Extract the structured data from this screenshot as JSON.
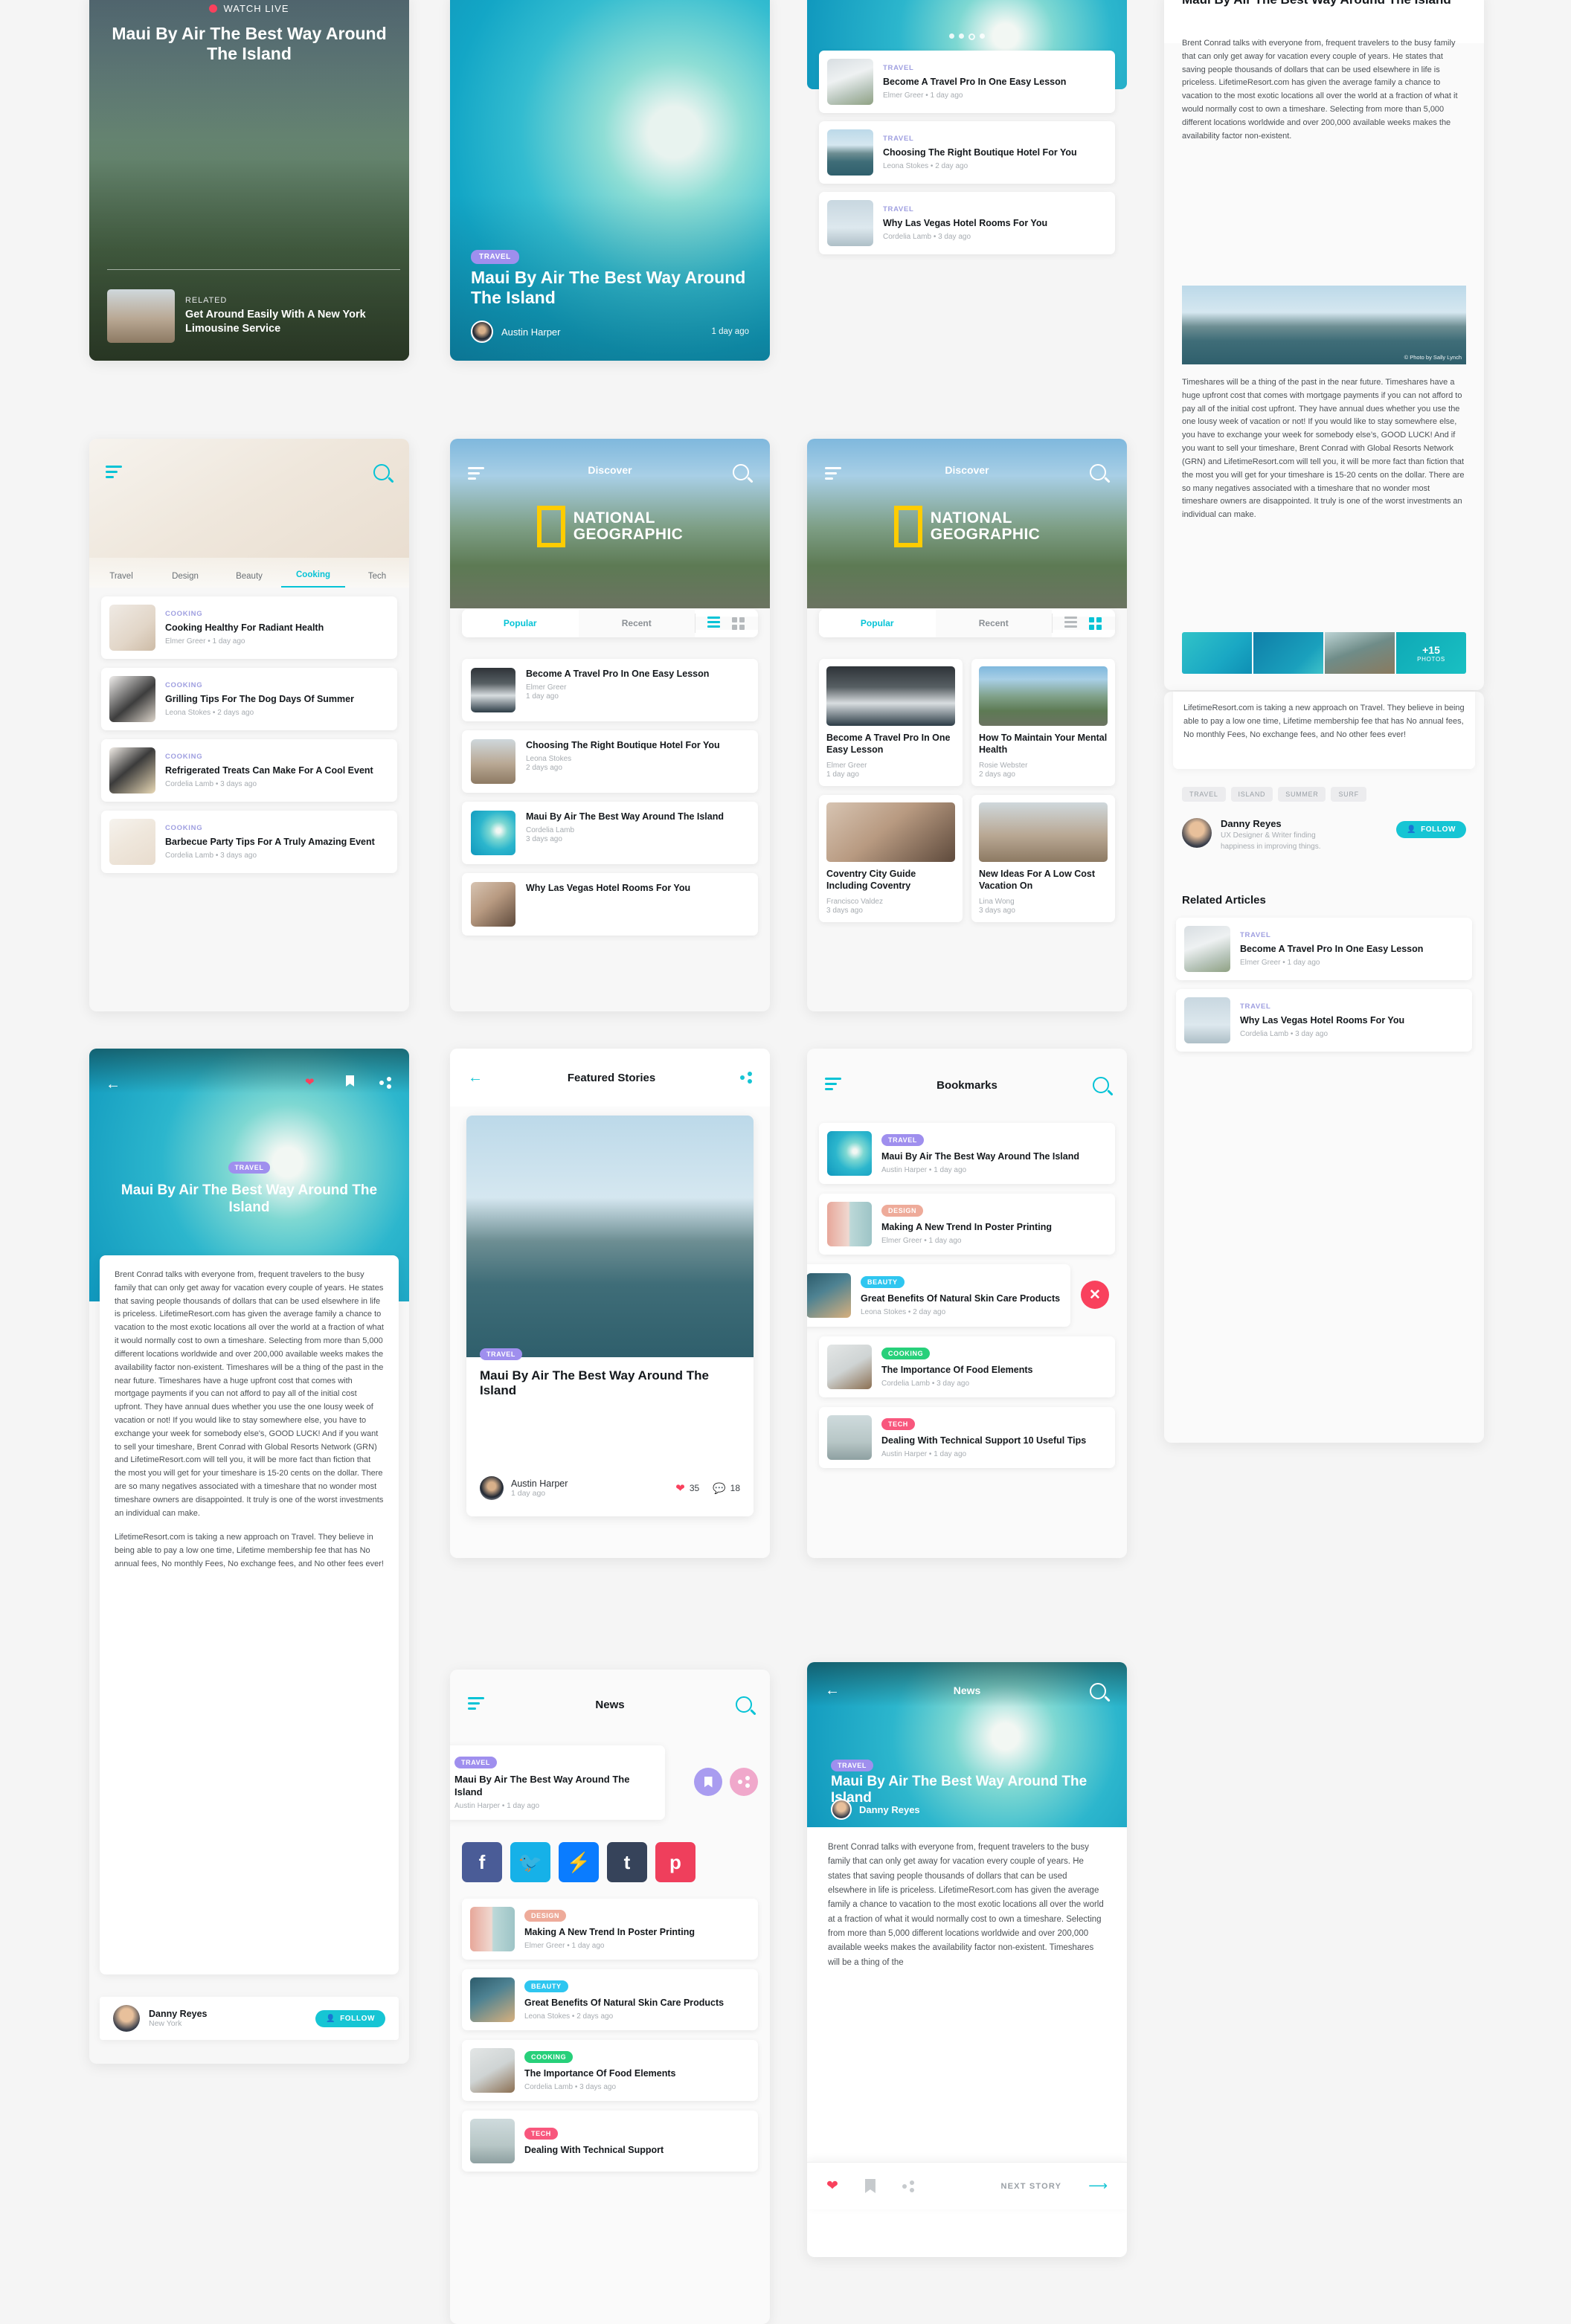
{
  "brand": {
    "accent": "#05c3d6",
    "red": "#f9415d",
    "purple": "#9f8fee"
  },
  "screen1_watch_live": {
    "live_label": "WATCH LIVE",
    "title": "Maui By Air The Best Way Around The Island",
    "related_label": "RELATED",
    "related_title": "Get Around Easily With A New York Limousine Service"
  },
  "screen2_hero": {
    "tag": "TRAVEL",
    "title": "Maui By Air The Best Way Around The Island",
    "author": "Austin Harper",
    "time": "1 day ago"
  },
  "screen3_carousel": {
    "dots": 5,
    "active_dot": 3,
    "items": [
      {
        "cat": "TRAVEL",
        "title": "Become A Travel Pro In One Easy Lesson",
        "meta": "Elmer Greer • 1 day ago"
      },
      {
        "cat": "TRAVEL",
        "title": "Choosing The Right Boutique Hotel For You",
        "meta": "Leona Stokes • 2 day ago"
      },
      {
        "cat": "TRAVEL",
        "title": "Why Las Vegas Hotel Rooms For You",
        "meta": "Cordelia Lamb • 3 day ago"
      }
    ]
  },
  "screen4_article": {
    "title": "Maui By Air The Best Way Around The Island",
    "paragraph1": "Brent Conrad talks with everyone from, frequent travelers to the busy family that can only get away for vacation every couple of years. He states that saving people thousands of dollars that can be used elsewhere in life is priceless. LifetimeResort.com has given the average family a chance to vacation to the most exotic locations all over the world at a fraction of what it would normally cost to own a timeshare. Selecting from more than 5,000 different locations worldwide and over 200,000 available weeks makes the availability factor non-existent.",
    "photo_credit": "© Photo by Sally Lynch",
    "paragraph2": "Timeshares will be a thing of the past in the near future. Timeshares have a huge upfront cost that comes with mortgage payments if you can not afford to pay all of the initial cost upfront. They have annual dues whether you use the one lousy week of vacation or not! If you would like to stay somewhere else, you have to exchange your week for somebody else’s, GOOD LUCK! And if you want to sell your timeshare, Brent Conrad with Global Resorts Network (GRN) and LifetimeResort.com will tell you, it will be more fact than fiction that the most you will get for your timeshare is 15-20 cents on the dollar. There are so many negatives associated with a timeshare that no wonder most timeshare owners are disappointed. It truly is one of the worst investments an individual can make.",
    "photos_count": "+15",
    "photos_label": "PHOTOS",
    "paragraph3": "LifetimeResort.com is taking a new approach on Travel. They believe in being able to pay a low one time, Lifetime membership fee that has No annual fees, No monthly Fees, No exchange fees, and No other fees ever!",
    "chips": [
      "TRAVEL",
      "ISLAND",
      "SUMMER",
      "SURF"
    ],
    "author_name": "Danny Reyes",
    "author_bio": "UX Designer & Writer finding happiness in improving things.",
    "follow_label": "FOLLOW",
    "related_heading": "Related Articles",
    "related": [
      {
        "cat": "TRAVEL",
        "title": "Become A Travel Pro In One Easy Lesson",
        "meta": "Elmer Greer • 1 day ago"
      },
      {
        "cat": "TRAVEL",
        "title": "Why Las Vegas Hotel Rooms For You",
        "meta": "Cordelia Lamb • 3 day ago"
      }
    ]
  },
  "screen5_cooking": {
    "tabs": [
      "Travel",
      "Design",
      "Beauty",
      "Cooking",
      "Tech"
    ],
    "active_tab": "Cooking",
    "items": [
      {
        "cat": "COOKING",
        "title": "Cooking Healthy For Radiant Health",
        "meta": "Elmer Greer • 1 day ago"
      },
      {
        "cat": "COOKING",
        "title": "Grilling Tips For The Dog Days Of Summer",
        "meta": "Leona Stokes • 2 days ago"
      },
      {
        "cat": "COOKING",
        "title": "Refrigerated Treats Can Make For A Cool Event",
        "meta": "Cordelia Lamb • 3 days ago"
      },
      {
        "cat": "COOKING",
        "title": "Barbecue Party Tips For A Truly Amazing Event",
        "meta": "Cordelia Lamb • 3 days ago"
      }
    ]
  },
  "screen6_discover_list": {
    "header_title": "Discover",
    "logo_line1": "NATIONAL",
    "logo_line2": "GEOGRAPHIC",
    "tabs": [
      "Popular",
      "Recent"
    ],
    "active_tab": "Popular",
    "view_mode": "list",
    "items": [
      {
        "title": "Become A Travel Pro In One Easy Lesson",
        "author": "Elmer Greer",
        "time": "1 day ago"
      },
      {
        "title": "Choosing The Right Boutique Hotel For You",
        "author": "Leona Stokes",
        "time": "2 days ago"
      },
      {
        "title": "Maui By Air The Best Way Around The Island",
        "author": "Cordelia Lamb",
        "time": "3 days ago"
      },
      {
        "title": "Why Las Vegas Hotel Rooms For You",
        "author": "",
        "time": ""
      }
    ]
  },
  "screen7_discover_grid": {
    "header_title": "Discover",
    "logo_line1": "NATIONAL",
    "logo_line2": "GEOGRAPHIC",
    "tabs": [
      "Popular",
      "Recent"
    ],
    "active_tab": "Popular",
    "view_mode": "grid",
    "items": [
      {
        "title": "Become A Travel Pro In One Easy Lesson",
        "author": "Elmer Greer",
        "time": "1 day ago"
      },
      {
        "title": "How To Maintain Your Mental Health",
        "author": "Rosie Webster",
        "time": "2 days ago"
      },
      {
        "title": "Coventry City Guide Including Coventry",
        "author": "Francisco Valdez",
        "time": "3 days ago"
      },
      {
        "title": "New Ideas For A Low Cost Vacation On",
        "author": "Lina Wong",
        "time": "3 days ago"
      }
    ]
  },
  "screen8_reader": {
    "tag": "TRAVEL",
    "title": "Maui By Air The Best Way Around The Island",
    "paragraph1": "Brent Conrad talks with everyone from, frequent travelers to the busy family that can only get away for vacation every couple of years. He states that saving people thousands of dollars that can be used elsewhere in life is priceless. LifetimeResort.com has given the average family a chance to vacation to the most exotic locations all over the world at a fraction of what it would normally cost to own a timeshare. Selecting from more than 5,000 different locations worldwide and over 200,000 available weeks makes the availability factor non-existent. Timeshares will be a thing of the past in the near future. Timeshares have a huge upfront cost that comes with mortgage payments if you can not afford to pay all of the initial cost upfront. They have annual dues whether you use the one lousy week of vacation or not! If you would like to stay somewhere else, you have to exchange your week for somebody else's, GOOD LUCK! And if you want to sell your timeshare, Brent Conrad with Global Resorts Network (GRN) and LifetimeResort.com will tell you, it will be more fact than fiction that the most you will get for your timeshare is 15-20 cents on the dollar. There are so many negatives associated with a timeshare that no wonder most timeshare owners are disappointed. It truly is one of the worst investments an individual can make.",
    "paragraph2": "LifetimeResort.com is taking a new approach on Travel. They believe in being able to pay a low one time, Lifetime membership fee that has No annual fees, No monthly Fees, No exchange fees, and No other fees ever!",
    "author_name": "Danny Reyes",
    "author_location": "New York",
    "follow_label": "FOLLOW"
  },
  "screen9_featured": {
    "header_title": "Featured Stories",
    "tag": "TRAVEL",
    "title": "Maui By Air The Best Way Around The Island",
    "author": "Austin Harper",
    "time": "1 day ago",
    "likes": "35",
    "comments": "18"
  },
  "screen10_bookmarks": {
    "header_title": "Bookmarks",
    "items": [
      {
        "tag": "TRAVEL",
        "tag_class": "travel",
        "title": "Maui By Air The Best Way Around The Island",
        "meta": "Austin Harper • 1 day ago",
        "swiped": false
      },
      {
        "tag": "DESIGN",
        "tag_class": "design",
        "title": "Making A New Trend In Poster Printing",
        "meta": "Elmer Greer • 1 day ago",
        "swiped": false
      },
      {
        "tag": "BEAUTY",
        "tag_class": "beauty",
        "title": "Great Benefits Of Natural Skin Care Products",
        "meta": "Leona Stokes • 2 day ago",
        "swiped": true
      },
      {
        "tag": "COOKING",
        "tag_class": "cooking",
        "title": "The Importance Of Food Elements",
        "meta": "Cordelia Lamb • 3 day ago",
        "swiped": false
      },
      {
        "tag": "TECH",
        "tag_class": "tech",
        "title": "Dealing With Technical Support 10 Useful Tips",
        "meta": "Austin Harper • 1 day ago",
        "swiped": false
      }
    ]
  },
  "screen11_news_share": {
    "header_title": "News",
    "tag": "TRAVEL",
    "title": "Maui By Air The Best Way Around The Island",
    "meta": "Austin Harper • 1 day ago",
    "social": [
      "facebook",
      "twitter",
      "messenger",
      "tumblr",
      "pinterest"
    ],
    "items": [
      {
        "tag": "DESIGN",
        "tag_class": "design",
        "title": "Making A New Trend In Poster Printing",
        "meta": "Elmer Greer • 1 day ago"
      },
      {
        "tag": "BEAUTY",
        "tag_class": "beauty",
        "title": "Great Benefits Of Natural Skin Care Products",
        "meta": "Leona Stokes • 2 days ago"
      },
      {
        "tag": "COOKING",
        "tag_class": "cooking",
        "title": "The Importance Of Food Elements",
        "meta": "Cordelia Lamb • 3 days ago"
      },
      {
        "tag": "TECH",
        "tag_class": "tech",
        "title": "Dealing With Technical Support",
        "meta": ""
      }
    ]
  },
  "screen12_news_article": {
    "header_title": "News",
    "tag": "TRAVEL",
    "title": "Maui By Air The Best Way Around The Island",
    "author": "Danny Reyes",
    "body": "Brent Conrad talks with everyone from, frequent travelers to the busy family that can only get away for vacation every couple of years. He states that saving people thousands of dollars that can be used elsewhere in life is priceless. LifetimeResort.com has given the average family a chance to vacation to the most exotic locations all over the world at a fraction of what it would normally cost to own a timeshare. Selecting from more than 5,000 different locations worldwide and over 200,000 available weeks makes the availability factor non-existent. Timeshares will be a thing of the",
    "next_label": "NEXT STORY"
  }
}
